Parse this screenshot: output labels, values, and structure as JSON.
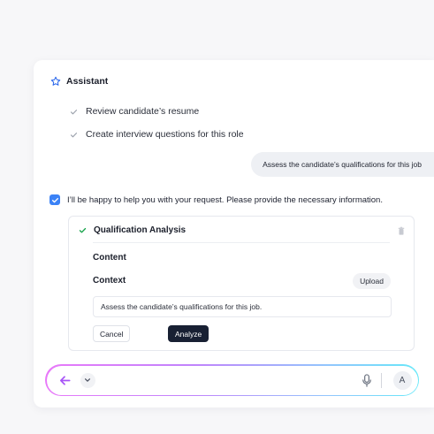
{
  "header": {
    "title": "Assistant",
    "icon": "star-icon"
  },
  "tasks": [
    {
      "label": "Review candidate’s resume",
      "done": true
    },
    {
      "label": "Create interview questions for this role",
      "done": true
    }
  ],
  "user_message": "Assess the candidate’s qualifications for this job",
  "assistant_reply": "I’ll be happy to help you with your request. Please provide the necessary information.",
  "panel": {
    "title": "Qualification Analysis",
    "content_label": "Content",
    "context_label": "Context",
    "upload_label": "Upload",
    "context_value": "Assess the candidate’s qualifications for this job.",
    "cancel_label": "Cancel",
    "analyze_label": "Analyze"
  },
  "composer": {
    "avatar_letter": "A",
    "icons": [
      "back-arrow-icon",
      "chevron-down-icon",
      "microphone-icon"
    ]
  },
  "colors": {
    "accent": "#3b82f6",
    "success": "#16a34a",
    "primary_button": "#182033",
    "gradient": [
      "#e879f9",
      "#c084fc",
      "#93c5fd",
      "#67e8f9"
    ]
  }
}
